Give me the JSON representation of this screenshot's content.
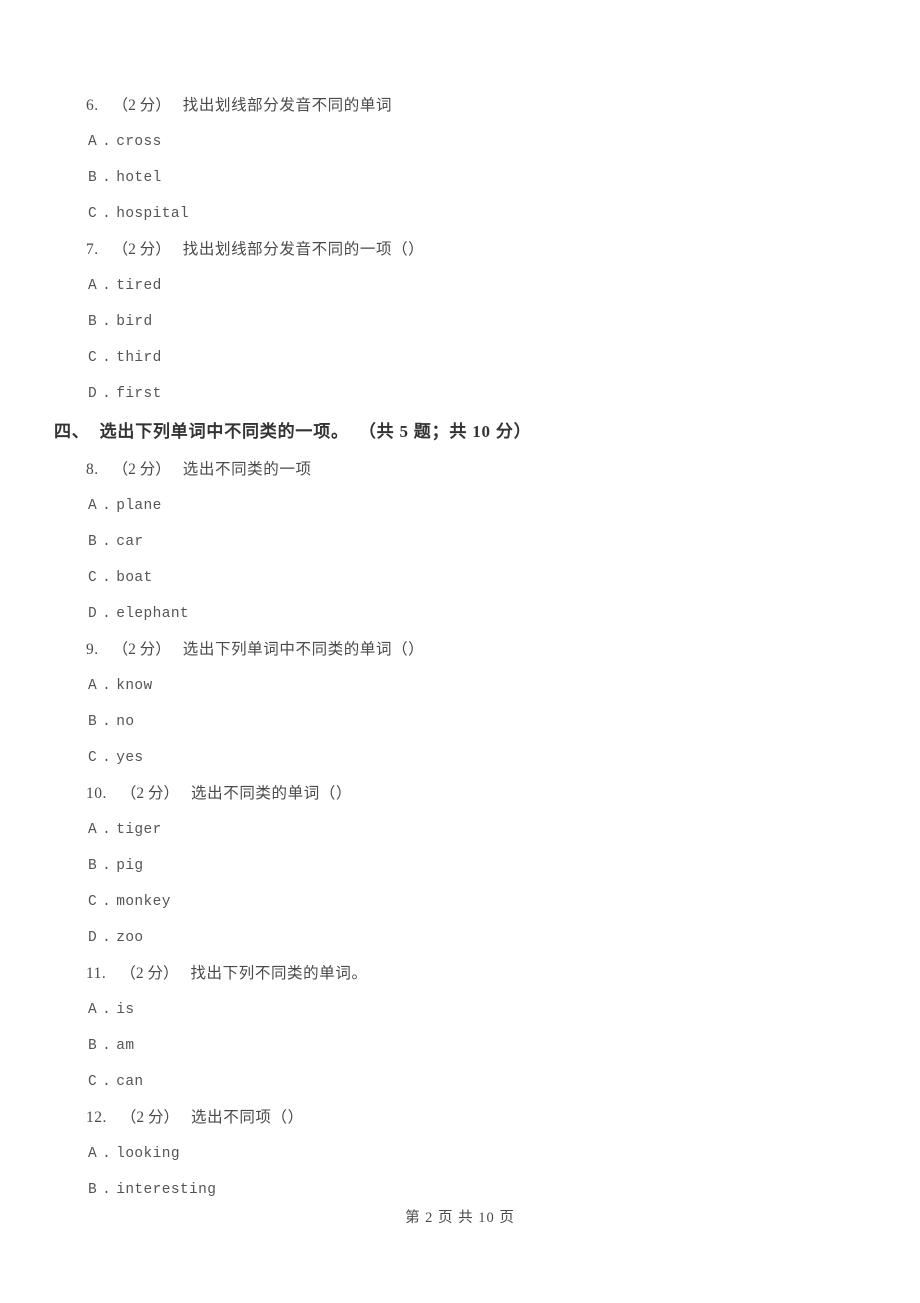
{
  "page": {
    "footer": "第 2 页 共 10 页",
    "page_number": "2",
    "total_pages": "10",
    "text_color": "#4f4f4f",
    "background_color": "#ffffff"
  },
  "blocks": [
    {
      "kind": "question",
      "number": "6.",
      "score": "（2 分）",
      "text": "找出划线部分发音不同的单词",
      "blank": "",
      "options": [
        {
          "letter": "A",
          "dot": ".",
          "text": "cross"
        },
        {
          "letter": "B",
          "dot": ".",
          "text": "hotel"
        },
        {
          "letter": "C",
          "dot": ".",
          "text": "hospital"
        }
      ]
    },
    {
      "kind": "question",
      "number": "7.",
      "score": "（2 分）",
      "text": "找出划线部分发音不同的一项（",
      "blank": "      ）",
      "options": [
        {
          "letter": "A",
          "dot": ".",
          "text": "tired"
        },
        {
          "letter": "B",
          "dot": ".",
          "text": "bird"
        },
        {
          "letter": "C",
          "dot": ".",
          "text": "third"
        },
        {
          "letter": "D",
          "dot": ".",
          "text": "first"
        }
      ]
    },
    {
      "kind": "section",
      "label": "四、",
      "title": "选出下列单词中不同类的一项。",
      "meta": "（共 5 题；共 10 分）"
    },
    {
      "kind": "question",
      "number": "8.",
      "score": "（2 分）",
      "text": "选出不同类的一项",
      "blank": "",
      "options": [
        {
          "letter": "A",
          "dot": ".",
          "text": "plane"
        },
        {
          "letter": "B",
          "dot": ".",
          "text": "car"
        },
        {
          "letter": "C",
          "dot": ".",
          "text": "boat"
        },
        {
          "letter": "D",
          "dot": ".",
          "text": "elephant"
        }
      ]
    },
    {
      "kind": "question",
      "number": "9.",
      "score": "（2 分）",
      "text": "选出下列单词中不同类的单词（",
      "blank": "      ）",
      "options": [
        {
          "letter": "A",
          "dot": ".",
          "text": "know"
        },
        {
          "letter": "B",
          "dot": ".",
          "text": "no"
        },
        {
          "letter": "C",
          "dot": ".",
          "text": "yes"
        }
      ]
    },
    {
      "kind": "question",
      "number": "10.",
      "score": "（2 分）",
      "text": "选出不同类的单词（",
      "blank": "      ）",
      "options": [
        {
          "letter": "A",
          "dot": ".",
          "text": "tiger"
        },
        {
          "letter": "B",
          "dot": ".",
          "text": "pig"
        },
        {
          "letter": "C",
          "dot": ".",
          "text": "monkey"
        },
        {
          "letter": "D",
          "dot": ".",
          "text": "zoo"
        }
      ]
    },
    {
      "kind": "question",
      "number": "11.",
      "score": "（2 分）",
      "text": "找出下列不同类的单词。",
      "blank": "",
      "options": [
        {
          "letter": "A",
          "dot": ".",
          "text": "is"
        },
        {
          "letter": "B",
          "dot": ".",
          "text": "am"
        },
        {
          "letter": "C",
          "dot": ".",
          "text": "can"
        }
      ]
    },
    {
      "kind": "question",
      "number": "12.",
      "score": "（2 分）",
      "text": "选出不同项（",
      "blank": "      ）",
      "options": [
        {
          "letter": "A",
          "dot": ".",
          "text": "looking"
        },
        {
          "letter": "B",
          "dot": ".",
          "text": "interesting"
        }
      ]
    }
  ]
}
